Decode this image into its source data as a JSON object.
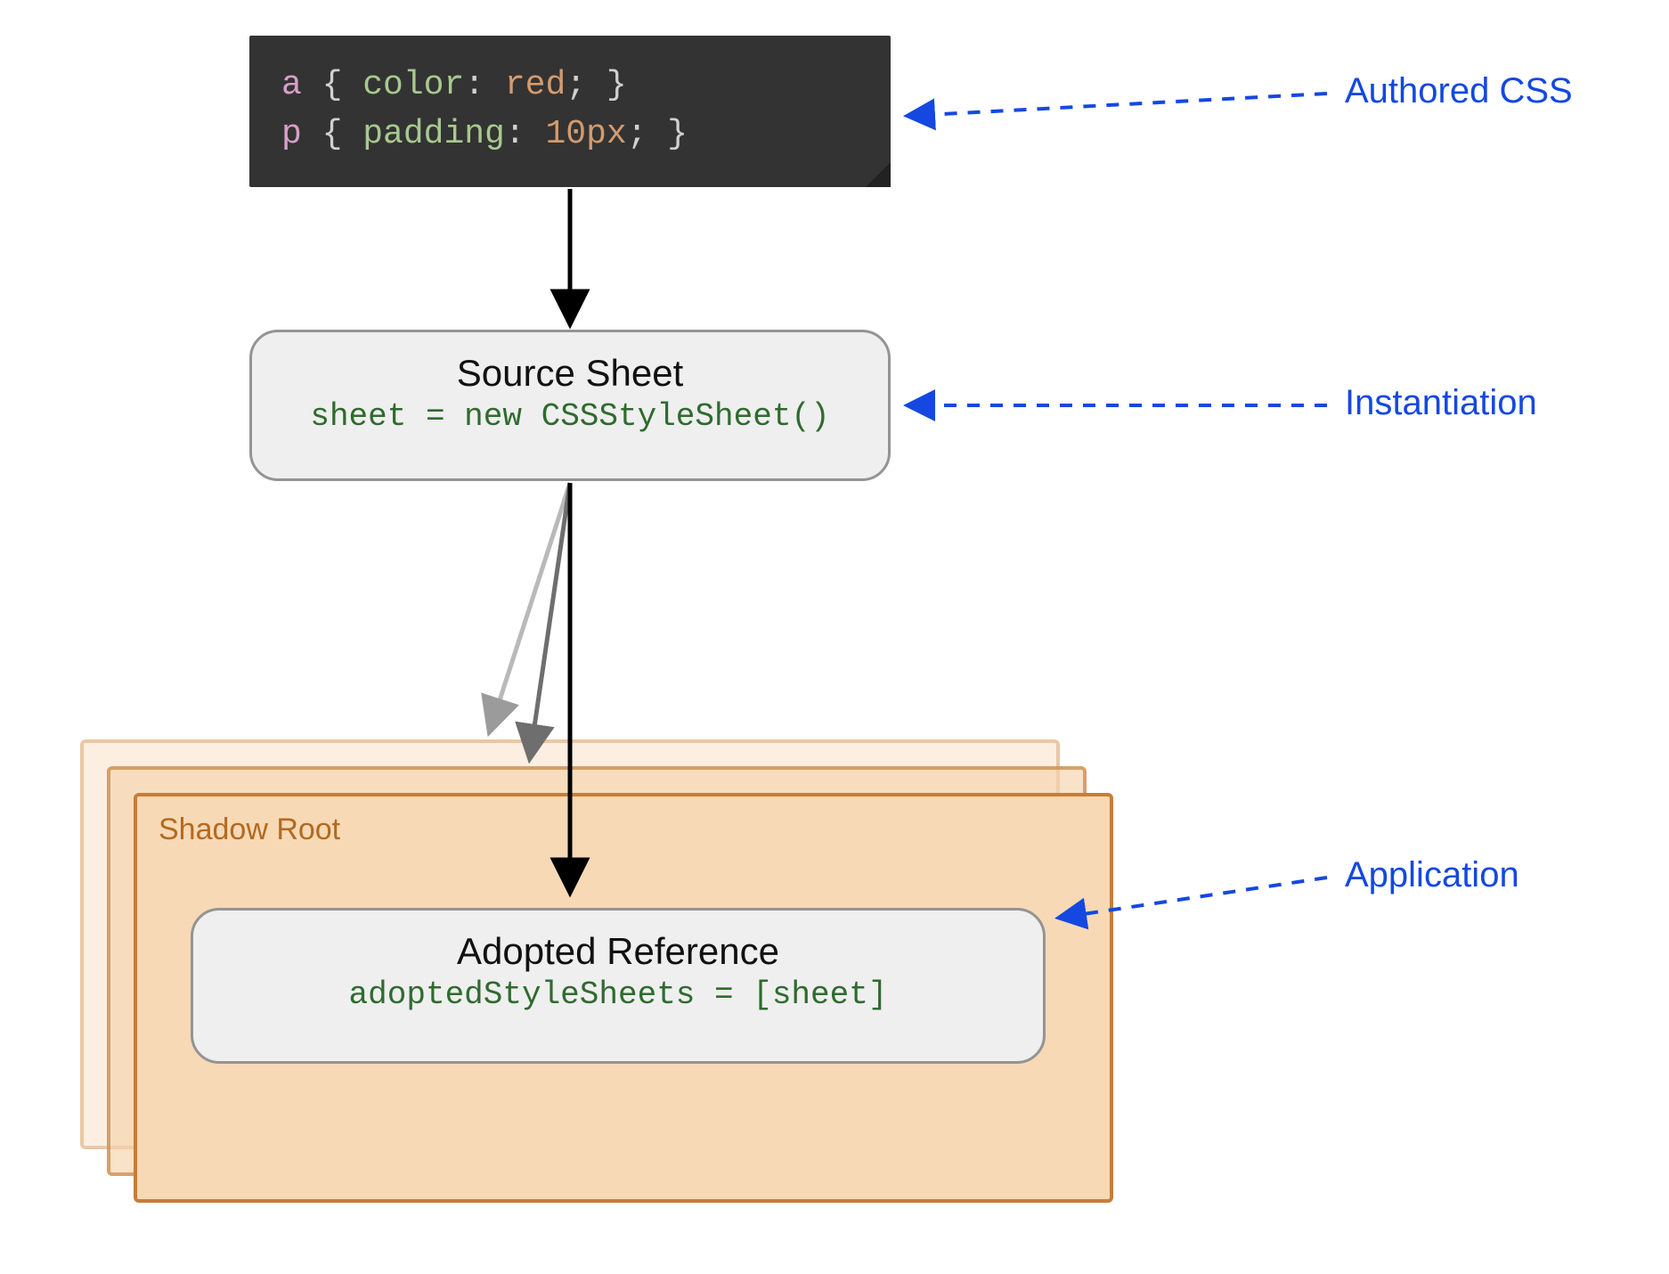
{
  "code_block": {
    "line1": {
      "selector": "a",
      "property": "color",
      "value": "red"
    },
    "line2": {
      "selector": "p",
      "property": "padding",
      "value": "10px"
    }
  },
  "source_box": {
    "title": "Source Sheet",
    "code": "sheet = new CSSStyleSheet()"
  },
  "shadow_root": {
    "label": "Shadow Root"
  },
  "adopted_box": {
    "title": "Adopted Reference",
    "code": "adoptedStyleSheets = [sheet]"
  },
  "annotations": {
    "authored": "Authored CSS",
    "instantiation": "Instantiation",
    "application": "Application"
  }
}
